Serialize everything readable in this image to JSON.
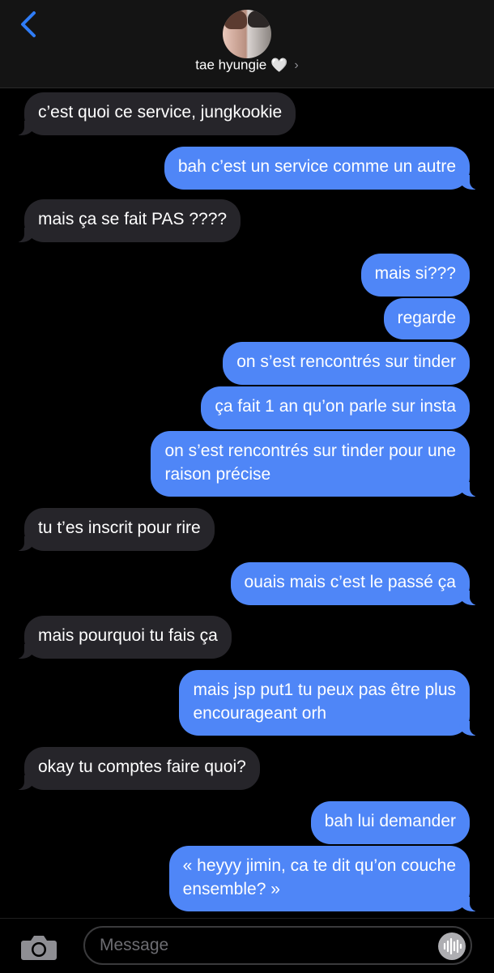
{
  "header": {
    "contact_name": "tae hyungie",
    "heart_icon": "🤍",
    "chevron_icon": "›"
  },
  "messages": [
    {
      "from": "them",
      "lines": [
        "c’est quoi ce service, jungkookie"
      ]
    },
    {
      "from": "me",
      "lines": [
        "bah c’est un service comme un autre"
      ]
    },
    {
      "from": "them",
      "lines": [
        "mais ça se fait PAS ????"
      ]
    },
    {
      "from": "me",
      "lines": [
        "mais si???"
      ]
    },
    {
      "from": "me",
      "lines": [
        "regarde"
      ]
    },
    {
      "from": "me",
      "lines": [
        "on s’est rencontrés sur tinder"
      ]
    },
    {
      "from": "me",
      "lines": [
        "ça fait 1 an qu’on parle sur insta"
      ]
    },
    {
      "from": "me",
      "lines": [
        "on s’est rencontrés sur tinder pour une",
        "raison précise"
      ]
    },
    {
      "from": "them",
      "lines": [
        "tu t’es inscrit pour rire"
      ]
    },
    {
      "from": "me",
      "lines": [
        "ouais mais c’est le passé ça"
      ]
    },
    {
      "from": "them",
      "lines": [
        "mais pourquoi tu fais ça"
      ]
    },
    {
      "from": "me",
      "lines": [
        "mais jsp put1 tu peux pas être plus",
        "encourageant orh"
      ]
    },
    {
      "from": "them",
      "lines": [
        "okay tu comptes faire quoi?"
      ]
    },
    {
      "from": "me",
      "lines": [
        "bah lui demander"
      ]
    },
    {
      "from": "me",
      "lines": [
        "« heyyy jimin, ca te dit qu’on couche",
        "ensemble? »"
      ]
    }
  ],
  "composer": {
    "placeholder": "Message"
  },
  "colors": {
    "incoming_bubble": "#26252a",
    "outgoing_bubble": "#4f86f7",
    "accent": "#2f7cf6",
    "background": "#000000"
  },
  "icons": {
    "back": "back-chevron-icon",
    "camera": "camera-icon",
    "audio": "audio-waveform-icon"
  }
}
